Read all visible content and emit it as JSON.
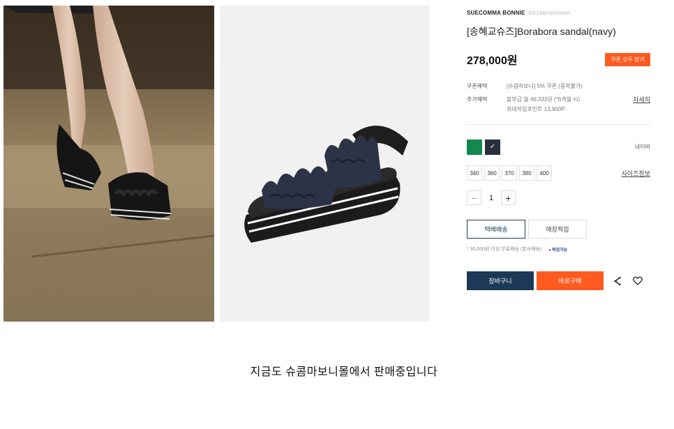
{
  "product": {
    "brand": "SUECOMMA BONNIE",
    "code": "DG2AM19065NAY",
    "title": "[송혜교슈즈]Borabora sandal(navy)",
    "price": "278,000원",
    "coupon_button": "쿠폰 모두 받기"
  },
  "benefits": {
    "coupon_label": "쿠폰혜택",
    "coupon_text": "[슈콤마보니] 5% 쿠폰 (중복불가)",
    "extra_label": "추가혜택",
    "installment_text": "할부금 월 46,333원 (*6개월 시)",
    "points_text": "최대적립포인트 13,900P",
    "detail_link": "자세히"
  },
  "options": {
    "colors": [
      {
        "name": "green",
        "hex": "#13894f",
        "selected": false
      },
      {
        "name": "navy",
        "hex": "#2a2f3c",
        "selected": true
      }
    ],
    "selected_color_name": "네이비",
    "sizes": [
      "340",
      "360",
      "370",
      "380",
      "400"
    ],
    "size_info_link": "사이즈정보",
    "quantity": "1"
  },
  "shipping": {
    "delivery_label": "택배배송",
    "pickup_label": "매장픽업",
    "note": "* 30,000원 이상 무료배송 (본사배송)",
    "pickup_badge": "픽업가능"
  },
  "actions": {
    "cart_label": "장바구니",
    "buy_label": "바로구매"
  },
  "footer": {
    "message": "지금도 슈콤마보니몰에서 판매중입니다"
  },
  "colors": {
    "accent_orange": "#ff5a1f",
    "navy_button": "#1c3a57"
  }
}
